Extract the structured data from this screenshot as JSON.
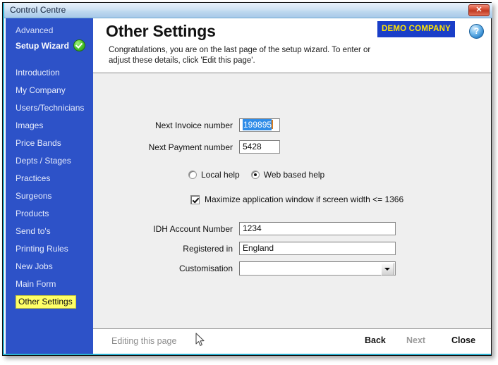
{
  "window": {
    "title": "Control Centre",
    "close_button": "✕"
  },
  "sidebar": {
    "heading_top": "Advanced",
    "heading_main": "Setup Wizard",
    "status_icon": "green-check-icon",
    "items": [
      {
        "label": "Introduction",
        "active": false
      },
      {
        "label": "My Company",
        "active": false
      },
      {
        "label": "Users/Technicians",
        "active": false
      },
      {
        "label": "Images",
        "active": false
      },
      {
        "label": "Price Bands",
        "active": false
      },
      {
        "label": "Depts / Stages",
        "active": false
      },
      {
        "label": "Practices",
        "active": false
      },
      {
        "label": "Surgeons",
        "active": false
      },
      {
        "label": "Products",
        "active": false
      },
      {
        "label": "Send to's",
        "active": false
      },
      {
        "label": "Printing Rules",
        "active": false
      },
      {
        "label": "New Jobs",
        "active": false
      },
      {
        "label": "Main Form",
        "active": false
      },
      {
        "label": "Other Settings",
        "active": true
      }
    ]
  },
  "header": {
    "title": "Other Settings",
    "description": "Congratulations, you are on the last page of the setup wizard. To enter or adjust these details, click 'Edit this page'.",
    "company_badge": "DEMO COMPANY",
    "help_icon_label": "?"
  },
  "form": {
    "invoice": {
      "label": "Next Invoice number",
      "value": "199895",
      "selected": true
    },
    "payment": {
      "label": "Next Payment number",
      "value": "5428"
    },
    "help_mode": {
      "options": [
        {
          "label": "Local help",
          "selected": false
        },
        {
          "label": "Web based help",
          "selected": true
        }
      ]
    },
    "maximize": {
      "label": "Maximize application window if screen width <= 1366",
      "checked": true
    },
    "idh_account": {
      "label": "IDH Account Number",
      "value": "1234"
    },
    "registered_in": {
      "label": "Registered in",
      "value": "England"
    },
    "customisation": {
      "label": "Customisation",
      "value": ""
    }
  },
  "footer": {
    "status": "Editing this page",
    "back": "Back",
    "next": "Next",
    "close": "Close"
  },
  "colors": {
    "sidebar_blue": "#2d52c8",
    "highlight_yellow": "#ffff66",
    "content_gray": "#efefef",
    "selection_blue": "#2f8ce8",
    "banner_blue": "#1a3ec8",
    "banner_yellow": "#ffe400",
    "frame_cyan": "#2bb0d0"
  }
}
